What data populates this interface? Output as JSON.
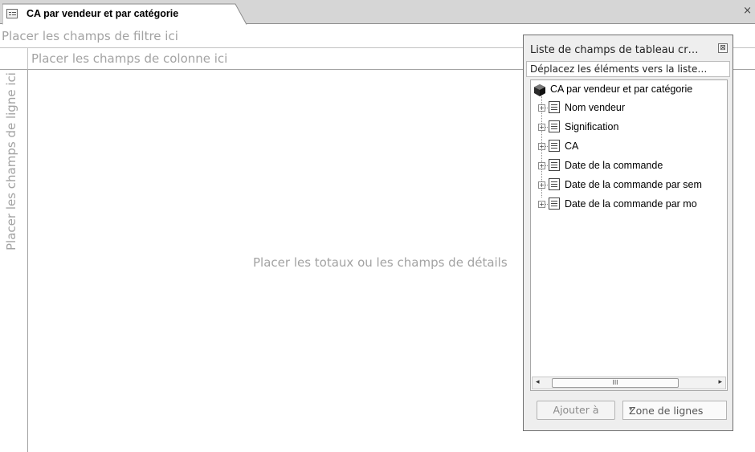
{
  "tab": {
    "title": "CA par vendeur et par catégorie",
    "icon": "table-icon",
    "close_label": "×"
  },
  "pivot": {
    "filter_placeholder": "Placer les champs de filtre ici",
    "column_placeholder": "Placer les champs de colonne ici",
    "row_placeholder": "Placer les champs de ligne ici",
    "detail_placeholder": "Placer les totaux ou les champs de détails"
  },
  "field_list": {
    "title": "Liste de champs de tableau cr…",
    "close_label": "⊠",
    "instruction": "Déplacez les éléments vers la liste…",
    "root": "CA par vendeur et par catégorie",
    "fields": [
      "Nom vendeur",
      "Signification",
      "CA",
      "Date de la commande",
      "Date de la commande par sem",
      "Date de la commande par mo"
    ],
    "scroll_left": "◂",
    "scroll_thumb": "III",
    "scroll_right": "▸",
    "add_button": "Ajouter à",
    "area_select": "Zone de lignes",
    "select_arrow": "▾"
  },
  "colors": {
    "placeholder_text": "#a3a3a3",
    "tab_background": "#ffffff",
    "panel_background": "#eeeeee"
  }
}
